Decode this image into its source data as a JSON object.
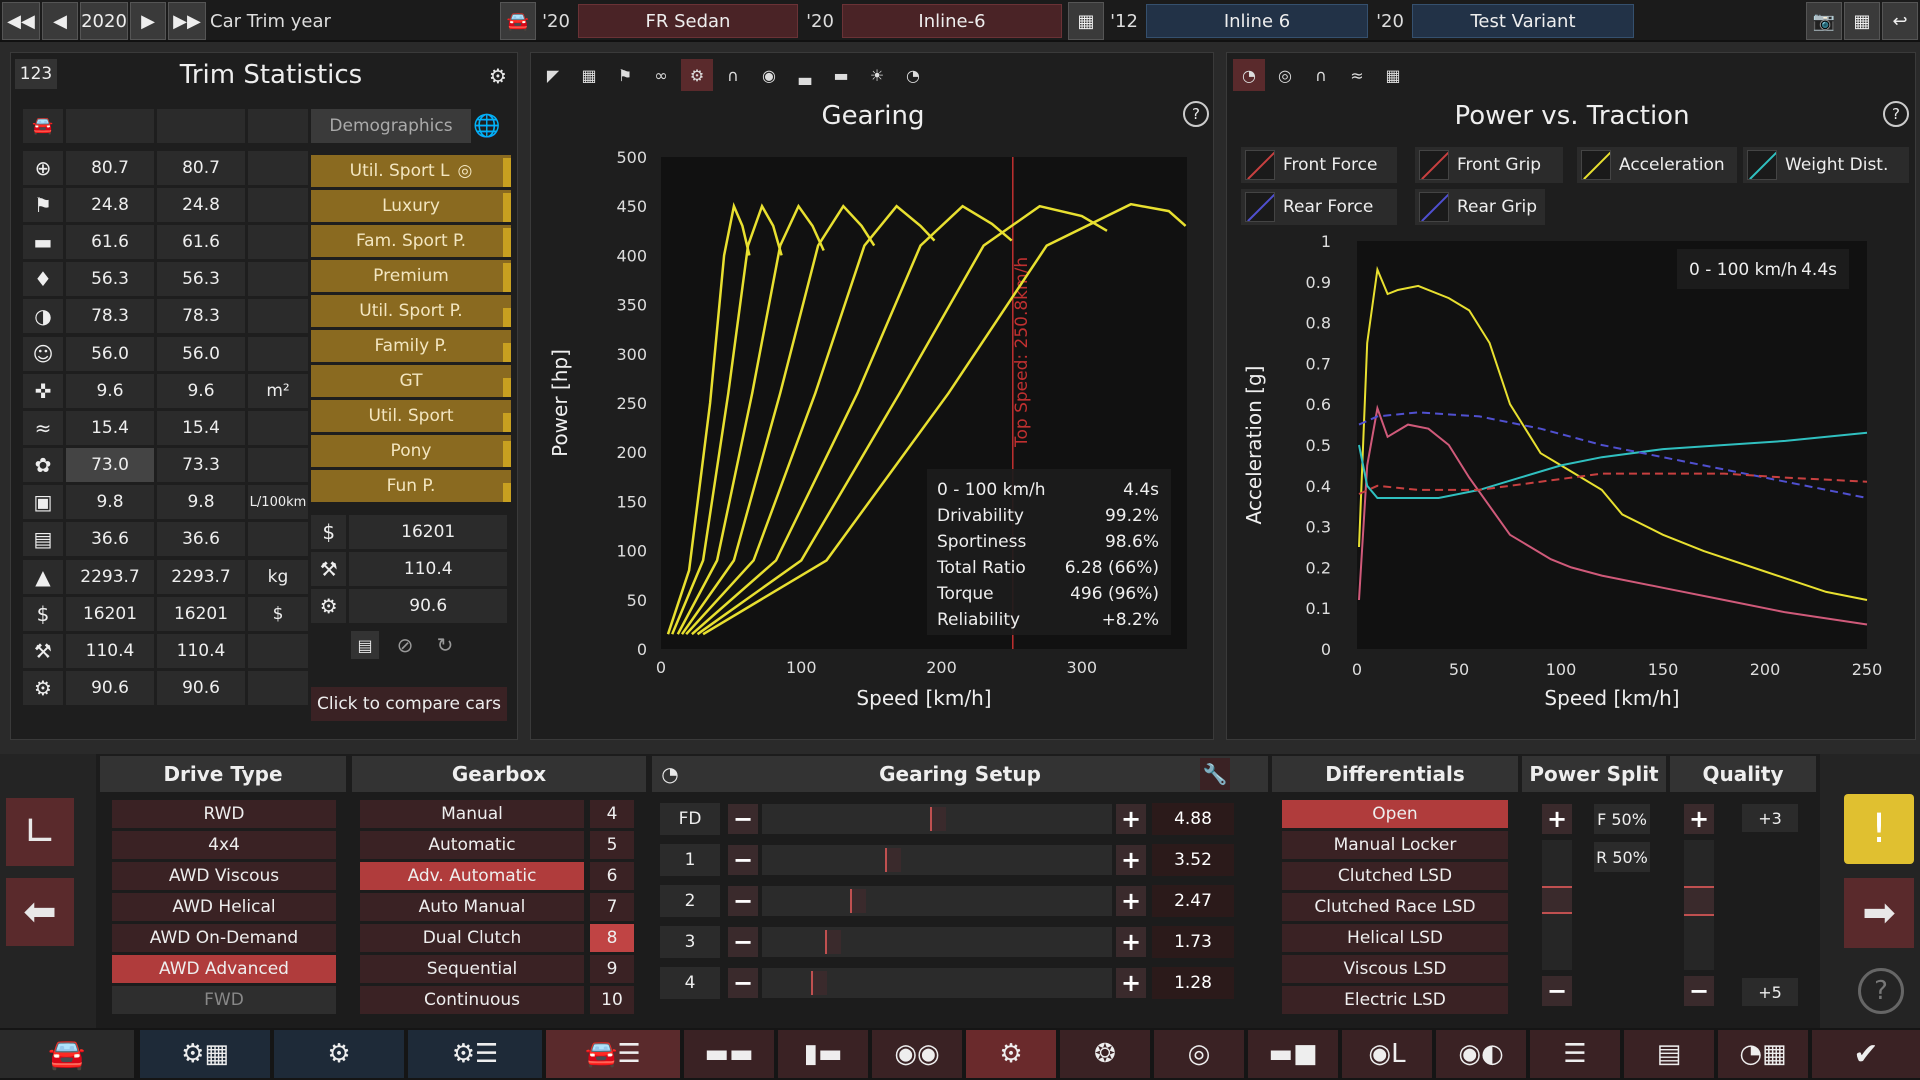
{
  "topbar": {
    "year": "2020",
    "year_label": "Car Trim year",
    "body_year": "'20",
    "body": "FR Sedan",
    "engine_year": "'20",
    "engine": "Inline-6",
    "family_year": "'12",
    "family": "Inline 6",
    "variant_year": "'20",
    "variant": "Test Variant"
  },
  "trim_stats": {
    "count": "123",
    "title": "Trim Statistics",
    "demographics_label": "Demographics",
    "rows": [
      {
        "icon": "steering-wheel-icon",
        "a": "80.7",
        "b": "80.7",
        "unit": ""
      },
      {
        "icon": "race-flag-icon",
        "a": "24.8",
        "b": "24.8",
        "unit": ""
      },
      {
        "icon": "comfort-seat-icon",
        "a": "61.6",
        "b": "61.6",
        "unit": ""
      },
      {
        "icon": "prestige-icon",
        "a": "56.3",
        "b": "56.3",
        "unit": ""
      },
      {
        "icon": "safety-icon",
        "a": "78.3",
        "b": "78.3",
        "unit": ""
      },
      {
        "icon": "passengers-icon",
        "a": "56.0",
        "b": "56.0",
        "unit": ""
      },
      {
        "icon": "size-icon",
        "a": "9.6",
        "b": "9.6",
        "unit": "m²"
      },
      {
        "icon": "offroad-icon",
        "a": "15.4",
        "b": "15.4",
        "unit": ""
      },
      {
        "icon": "environment-icon",
        "a": "73.0",
        "b": "73.3",
        "unit": ""
      },
      {
        "icon": "fuel-pump-icon",
        "a": "9.8",
        "b": "9.8",
        "unit": "L/100km"
      },
      {
        "icon": "cargo-icon",
        "a": "36.6",
        "b": "36.6",
        "unit": ""
      },
      {
        "icon": "weight-icon",
        "a": "2293.7",
        "b": "2293.7",
        "unit": "kg"
      },
      {
        "icon": "cost-icon",
        "a": "16201",
        "b": "16201",
        "unit": "$"
      },
      {
        "icon": "production-icon",
        "a": "110.4",
        "b": "110.4",
        "unit": ""
      },
      {
        "icon": "service-icon",
        "a": "90.6",
        "b": "90.6",
        "unit": ""
      }
    ],
    "demographics": [
      {
        "label": "Util. Sport L",
        "bar": 0.9
      },
      {
        "label": "Luxury",
        "bar": 0.9
      },
      {
        "label": "Fam. Sport P.",
        "bar": 0.9
      },
      {
        "label": "Premium",
        "bar": 0.9
      },
      {
        "label": "Util. Sport P.",
        "bar": 0.6
      },
      {
        "label": "Family P.",
        "bar": 0.6
      },
      {
        "label": "GT",
        "bar": 0.6
      },
      {
        "label": "Util. Sport",
        "bar": 0.6
      },
      {
        "label": "Pony",
        "bar": 0.8
      },
      {
        "label": "Fun P.",
        "bar": 0.6
      }
    ],
    "summary": [
      {
        "icon": "cost-icon",
        "value": "16201"
      },
      {
        "icon": "production-icon",
        "value": "110.4"
      },
      {
        "icon": "service-icon",
        "value": "90.6"
      }
    ],
    "compare_label": "Click to compare cars"
  },
  "gearing": {
    "title": "Gearing",
    "ylabel": "Power [hp]",
    "xlabel": "Speed [km/h]",
    "top_speed_label": "Top Speed: 250.8km/h",
    "stats": [
      {
        "k": "0 - 100 km/h",
        "v": "4.4s"
      },
      {
        "k": "Drivability",
        "v": "99.2%"
      },
      {
        "k": "Sportiness",
        "v": "98.6%"
      },
      {
        "k": "Total Ratio",
        "v": "6.28 (66%)"
      },
      {
        "k": "Torque",
        "v": "496 (96%)"
      },
      {
        "k": "Reliability",
        "v": "+8.2%"
      }
    ]
  },
  "traction": {
    "title": "Power vs. Traction",
    "ylabel": "Acceleration [g]",
    "xlabel": "Speed [km/h]",
    "accel_k": "0 - 100 km/h",
    "accel_v": "4.4s",
    "legend": [
      {
        "label": "Front Force",
        "color": "#c84040"
      },
      {
        "label": "Front Grip",
        "color": "#c84040"
      },
      {
        "label": "Acceleration",
        "color": "#e8e030"
      },
      {
        "label": "Weight Dist.",
        "color": "#30c0c0"
      },
      {
        "label": "Rear Force",
        "color": "#5050d0"
      },
      {
        "label": "Rear Grip",
        "color": "#5050d0"
      }
    ]
  },
  "chart_data": [
    {
      "type": "line",
      "title": "Gearing",
      "xlabel": "Speed [km/h]",
      "ylabel": "Power [hp]",
      "xlim": [
        0,
        375
      ],
      "ylim": [
        0,
        500
      ],
      "xticks": [
        0,
        100,
        200,
        300
      ],
      "yticks": [
        0,
        50,
        100,
        150,
        200,
        250,
        300,
        350,
        400,
        450,
        500
      ],
      "top_speed": 250.8,
      "series": [
        {
          "values": [
            [
              5,
              15
            ],
            [
              20,
              80
            ],
            [
              35,
              250
            ],
            [
              45,
              400
            ],
            [
              52,
              450
            ],
            [
              58,
              430
            ],
            [
              63,
              400
            ]
          ]
        },
        {
          "values": [
            [
              8,
              15
            ],
            [
              30,
              90
            ],
            [
              48,
              260
            ],
            [
              62,
              410
            ],
            [
              72,
              450
            ],
            [
              80,
              430
            ],
            [
              86,
              400
            ]
          ]
        },
        {
          "values": [
            [
              12,
              15
            ],
            [
              40,
              90
            ],
            [
              65,
              260
            ],
            [
              85,
              410
            ],
            [
              98,
              450
            ],
            [
              108,
              430
            ],
            [
              116,
              405
            ]
          ]
        },
        {
          "values": [
            [
              15,
              15
            ],
            [
              52,
              90
            ],
            [
              85,
              260
            ],
            [
              112,
              410
            ],
            [
              130,
              450
            ],
            [
              143,
              430
            ],
            [
              152,
              410
            ]
          ]
        },
        {
          "values": [
            [
              18,
              15
            ],
            [
              66,
              90
            ],
            [
              110,
              260
            ],
            [
              145,
              410
            ],
            [
              168,
              450
            ],
            [
              185,
              430
            ],
            [
              195,
              415
            ]
          ]
        },
        {
          "values": [
            [
              22,
              15
            ],
            [
              82,
              90
            ],
            [
              140,
              260
            ],
            [
              185,
              410
            ],
            [
              215,
              450
            ],
            [
              236,
              432
            ],
            [
              250,
              415
            ]
          ]
        },
        {
          "values": [
            [
              26,
              15
            ],
            [
              100,
              90
            ],
            [
              170,
              260
            ],
            [
              230,
              410
            ],
            [
              270,
              450
            ],
            [
              300,
              440
            ],
            [
              318,
              425
            ]
          ]
        },
        {
          "values": [
            [
              30,
              15
            ],
            [
              118,
              90
            ],
            [
              205,
              260
            ],
            [
              275,
              410
            ],
            [
              335,
              452
            ],
            [
              362,
              445
            ],
            [
              374,
              430
            ]
          ]
        }
      ]
    },
    {
      "type": "line",
      "title": "Power vs. Traction",
      "xlabel": "Speed [km/h]",
      "ylabel": "Acceleration [g]",
      "xlim": [
        0,
        250
      ],
      "ylim": [
        0,
        1
      ],
      "xticks": [
        0,
        50,
        100,
        150,
        200,
        250
      ],
      "yticks": [
        0,
        0.1,
        0.2,
        0.3,
        0.4,
        0.5,
        0.6,
        0.7,
        0.8,
        0.9,
        1
      ],
      "series": [
        {
          "name": "Acceleration",
          "color": "#e8e030",
          "dash": false,
          "values": [
            [
              1,
              0.25
            ],
            [
              5,
              0.75
            ],
            [
              10,
              0.93
            ],
            [
              15,
              0.87
            ],
            [
              20,
              0.88
            ],
            [
              30,
              0.89
            ],
            [
              45,
              0.86
            ],
            [
              55,
              0.83
            ],
            [
              65,
              0.75
            ],
            [
              75,
              0.6
            ],
            [
              85,
              0.52
            ],
            [
              90,
              0.48
            ],
            [
              100,
              0.45
            ],
            [
              110,
              0.42
            ],
            [
              120,
              0.39
            ],
            [
              130,
              0.33
            ],
            [
              150,
              0.28
            ],
            [
              170,
              0.24
            ],
            [
              200,
              0.19
            ],
            [
              230,
              0.14
            ],
            [
              250,
              0.12
            ]
          ]
        },
        {
          "name": "Front Force",
          "color": "#d05a7a",
          "dash": false,
          "values": [
            [
              1,
              0.12
            ],
            [
              5,
              0.45
            ],
            [
              10,
              0.59
            ],
            [
              15,
              0.52
            ],
            [
              25,
              0.55
            ],
            [
              35,
              0.54
            ],
            [
              45,
              0.5
            ],
            [
              55,
              0.42
            ],
            [
              65,
              0.35
            ],
            [
              75,
              0.28
            ],
            [
              85,
              0.25
            ],
            [
              95,
              0.22
            ],
            [
              105,
              0.2
            ],
            [
              120,
              0.18
            ],
            [
              150,
              0.15
            ],
            [
              180,
              0.12
            ],
            [
              210,
              0.09
            ],
            [
              250,
              0.06
            ]
          ]
        },
        {
          "name": "Weight Dist.",
          "color": "#30c0c0",
          "dash": false,
          "values": [
            [
              1,
              0.5
            ],
            [
              5,
              0.4
            ],
            [
              10,
              0.37
            ],
            [
              20,
              0.37
            ],
            [
              40,
              0.37
            ],
            [
              60,
              0.39
            ],
            [
              80,
              0.42
            ],
            [
              100,
              0.45
            ],
            [
              120,
              0.47
            ],
            [
              150,
              0.49
            ],
            [
              180,
              0.5
            ],
            [
              210,
              0.51
            ],
            [
              250,
              0.53
            ]
          ]
        },
        {
          "name": "Rear Grip",
          "color": "#5050d0",
          "dash": true,
          "values": [
            [
              1,
              0.55
            ],
            [
              10,
              0.57
            ],
            [
              30,
              0.58
            ],
            [
              60,
              0.57
            ],
            [
              90,
              0.54
            ],
            [
              120,
              0.5
            ],
            [
              150,
              0.47
            ],
            [
              180,
              0.44
            ],
            [
              210,
              0.41
            ],
            [
              250,
              0.37
            ]
          ]
        },
        {
          "name": "Front Grip",
          "color": "#c84040",
          "dash": true,
          "values": [
            [
              1,
              0.38
            ],
            [
              10,
              0.4
            ],
            [
              30,
              0.39
            ],
            [
              60,
              0.39
            ],
            [
              90,
              0.41
            ],
            [
              120,
              0.43
            ],
            [
              150,
              0.43
            ],
            [
              180,
              0.43
            ],
            [
              210,
              0.42
            ],
            [
              250,
              0.41
            ]
          ]
        }
      ]
    }
  ],
  "bottom": {
    "drive_type": {
      "title": "Drive Type",
      "options": [
        "RWD",
        "4x4",
        "AWD Viscous",
        "AWD Helical",
        "AWD On-Demand",
        "AWD Advanced",
        "FWD"
      ],
      "selected": 5
    },
    "gearbox": {
      "title": "Gearbox",
      "options": [
        "Manual",
        "Automatic",
        "Adv. Automatic",
        "Auto Manual",
        "Dual Clutch",
        "Sequential",
        "Continuous"
      ],
      "gears": [
        "4",
        "5",
        "6",
        "7",
        "8",
        "9",
        "10"
      ],
      "selected": 2,
      "gear_selected": 4
    },
    "gearing_setup": {
      "title": "Gearing Setup",
      "rows": [
        {
          "label": "FD",
          "value": "4.88",
          "pos": 0.48
        },
        {
          "label": "1",
          "value": "3.52",
          "pos": 0.35
        },
        {
          "label": "2",
          "value": "2.47",
          "pos": 0.25
        },
        {
          "label": "3",
          "value": "1.73",
          "pos": 0.18
        },
        {
          "label": "4",
          "value": "1.28",
          "pos": 0.14
        }
      ]
    },
    "differentials": {
      "title": "Differentials",
      "options": [
        "Open",
        "Manual Locker",
        "Clutched LSD",
        "Clutched Race LSD",
        "Helical LSD",
        "Viscous LSD",
        "Electric LSD"
      ],
      "selected": 0
    },
    "power_split": {
      "title": "Power Split",
      "front": "F 50%",
      "rear": "R 50%"
    },
    "quality": {
      "title": "Quality",
      "top": "+3",
      "bottom": "+5"
    }
  }
}
